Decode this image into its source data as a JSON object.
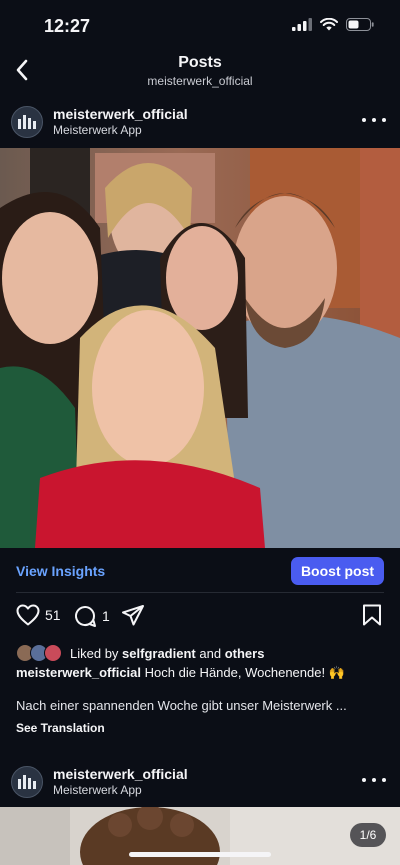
{
  "status_bar": {
    "time": "12:27"
  },
  "nav": {
    "title": "Posts",
    "subtitle": "meisterwerk_official"
  },
  "post": {
    "account_name": "meisterwerk_official",
    "account_subtitle": "Meisterwerk App",
    "insights_label": "View Insights",
    "boost_label": "Boost post",
    "like_count": "51",
    "comment_count": "1",
    "liked_by_prefix": "Liked by",
    "liked_by_user": "selfgradient",
    "liked_by_and": "and",
    "liked_by_others": "others",
    "caption_user": "meisterwerk_official",
    "caption_text": "Hoch die Hände, Wochenende! 🙌",
    "caption_body": "Nach einer spannenden Woche gibt unser Meisterwerk ...",
    "see_translation": "See Translation"
  },
  "next_post": {
    "account_name": "meisterwerk_official",
    "account_subtitle": "Meisterwerk App",
    "page_counter": "1/6"
  },
  "colors": {
    "background": "#0b0e16",
    "link": "#6aa3ff",
    "boost": "#4a5cf0"
  }
}
